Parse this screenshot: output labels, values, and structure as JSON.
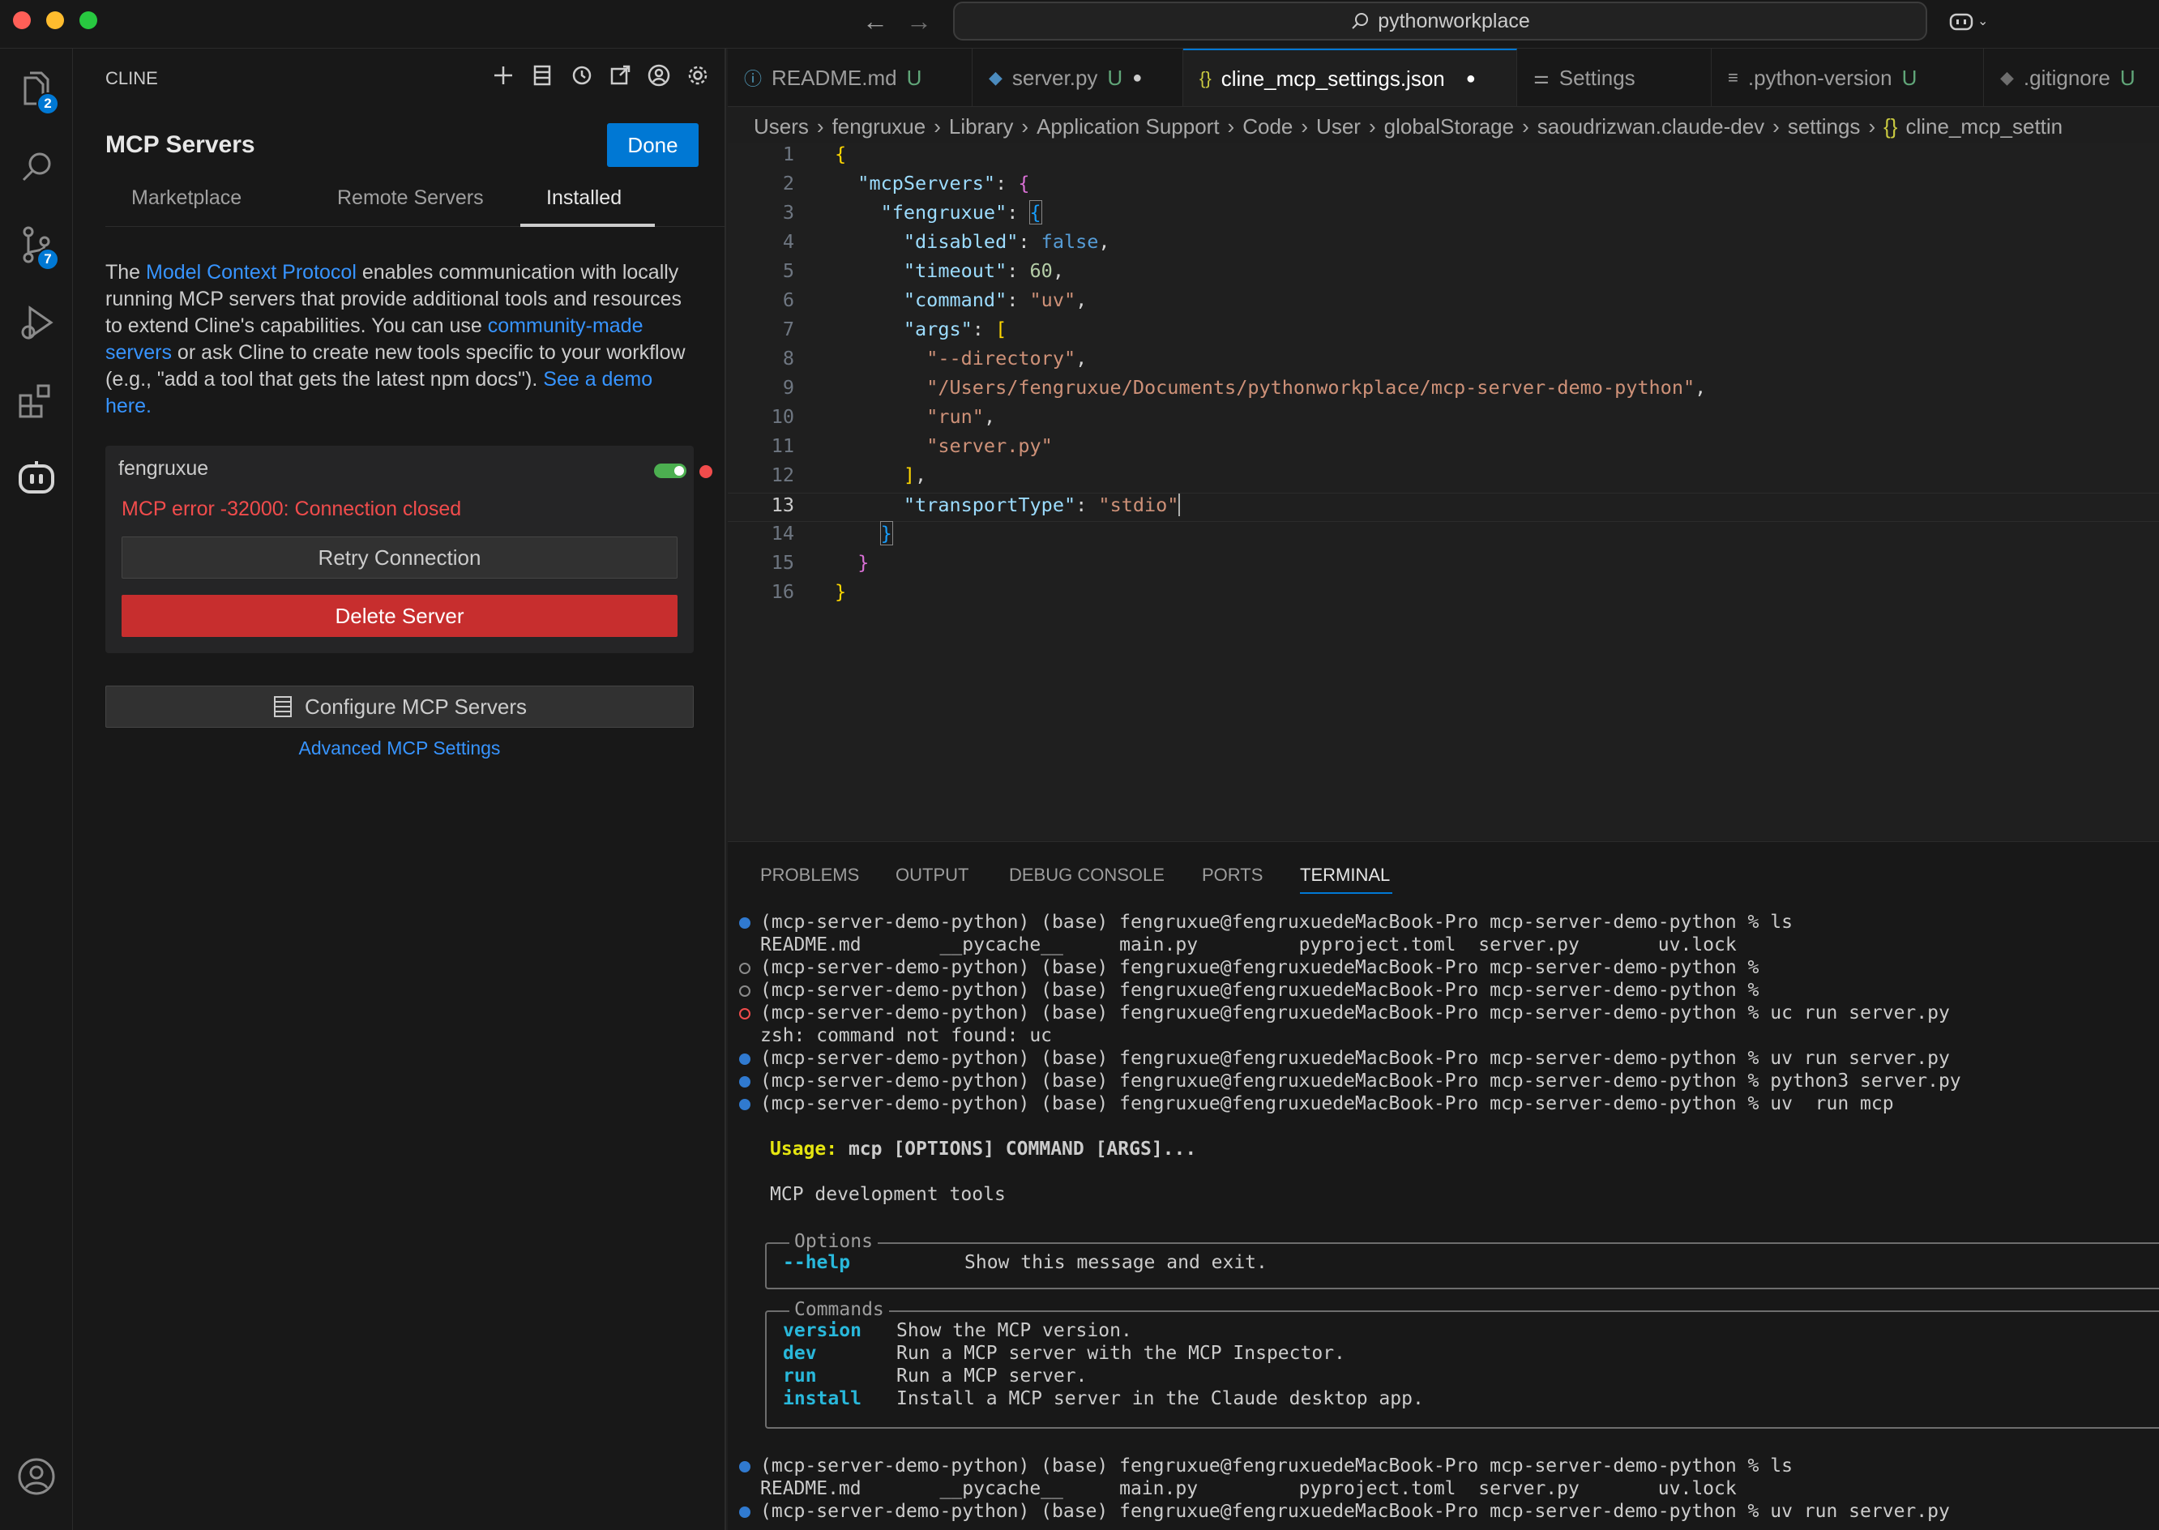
{
  "window": {
    "search_text": "pythonworkplace"
  },
  "activity": {
    "explorer_badge": "2",
    "scm_badge": "7"
  },
  "sidebar": {
    "header": "CLINE",
    "title": "MCP Servers",
    "done_label": "Done",
    "tabs": [
      "Marketplace",
      "Remote Servers",
      "Installed"
    ],
    "intro": {
      "t1": "The ",
      "link1": "Model Context Protocol",
      "t2": " enables communication with locally running MCP servers that provide additional tools and resources to extend Cline's capabilities. You can use ",
      "link2": "community-made servers",
      "t3": " or ask Cline to create new tools specific to your workflow (e.g., \"add a tool that gets the latest npm docs\"). ",
      "link3": "See a demo here."
    },
    "server": {
      "name": "fengruxue",
      "error": "MCP error -32000: Connection closed",
      "retry_label": "Retry Connection",
      "delete_label": "Delete Server"
    },
    "configure_label": "Configure MCP Servers",
    "advanced_label": "Advanced MCP Settings"
  },
  "editor_tabs": [
    {
      "label": "README.md",
      "status": "U"
    },
    {
      "label": "server.py",
      "status": "U"
    },
    {
      "label": "cline_mcp_settings.json",
      "status": ""
    },
    {
      "label": "Settings",
      "status": ""
    },
    {
      "label": ".python-version",
      "status": "U"
    },
    {
      "label": ".gitignore",
      "status": "U"
    }
  ],
  "breadcrumb": [
    "Users",
    "fengruxue",
    "Library",
    "Application Support",
    "Code",
    "User",
    "globalStorage",
    "saoudrizwan.claude-dev",
    "settings",
    "cline_mcp_settin"
  ],
  "code": {
    "current_line": 13,
    "key_mcpServers": "\"mcpServers\"",
    "key_fengruxue": "\"fengruxue\"",
    "key_disabled": "\"disabled\"",
    "val_disabled": "false",
    "key_timeout": "\"timeout\"",
    "val_timeout": "60",
    "key_command": "\"command\"",
    "val_command": "\"uv\"",
    "key_args": "\"args\"",
    "arg1": "\"--directory\"",
    "arg2": "\"/Users/fengruxue/Documents/pythonworkplace/mcp-server-demo-python\"",
    "arg3": "\"run\"",
    "arg4": "\"server.py\"",
    "key_transport": "\"transportType\"",
    "val_transport": "\"stdio\""
  },
  "panel_tabs": [
    "PROBLEMS",
    "OUTPUT",
    "DEBUG CONSOLE",
    "PORTS",
    "TERMINAL"
  ],
  "terminal": {
    "prompt": "(mcp-server-demo-python) (base) fengruxue@fengruxuedeMacBook-Pro mcp-server-demo-python % ",
    "cmd1": "ls",
    "ls_out": "README.md       __pycache__     main.py         pyproject.toml  server.py       uv.lock",
    "cmd2": "",
    "cmd3": "",
    "cmd4": "uc run server.py",
    "zsh_err": "zsh: command not found: uc",
    "cmd5": "uv run server.py",
    "cmd6": "python3 server.py",
    "cmd7": "uv  run mcp",
    "usage_label": "Usage:",
    "usage_text": " mcp [OPTIONS] COMMAND [ARGS]...",
    "desc": "MCP development tools",
    "options_title": "Options",
    "help_flag": "--help",
    "help_desc": "Show this message and exit.",
    "commands_title": "Commands",
    "commands": [
      {
        "name": "version",
        "desc": "Show the MCP version."
      },
      {
        "name": "dev",
        "desc": "Run a MCP server with the MCP Inspector."
      },
      {
        "name": "run",
        "desc": "Run a MCP server."
      },
      {
        "name": "install",
        "desc": "Install a MCP server in the Claude desktop app."
      }
    ],
    "cmd8": "ls",
    "cmd9": "uv run server.py"
  }
}
